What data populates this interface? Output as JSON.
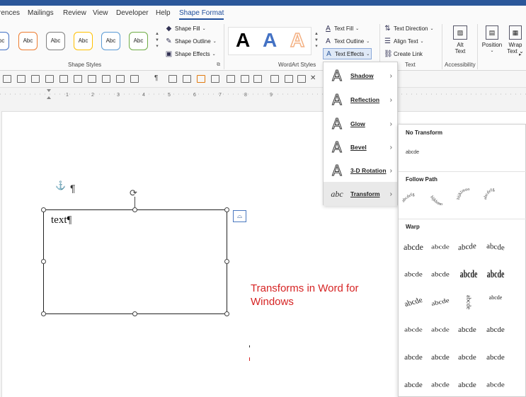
{
  "window": {
    "accent_color": "#2b579a",
    "menu_accent": "#1f4e9c"
  },
  "tabs": [
    "rences",
    "Mailings",
    "Review",
    "View",
    "Developer",
    "Help",
    "Shape Format"
  ],
  "ribbon": {
    "shape_styles": {
      "swatch_label": "Abc",
      "swatch_colors": [
        "#4472c4",
        "#ed7d31",
        "#7f7f7f",
        "#ffc000",
        "#5b9bd5",
        "#70ad47"
      ],
      "shape_fill": "Shape Fill",
      "shape_outline": "Shape Outline",
      "shape_effects": "Shape Effects",
      "group_label": "Shape Styles"
    },
    "wordart": {
      "letter": "A",
      "colors": [
        "#000000",
        "#4472c4",
        "#f4b183"
      ],
      "group_label": "WordArt Styles"
    },
    "text_group": {
      "text_fill": "Text Fill",
      "text_outline": "Text Outline",
      "text_effects": "Text Effects",
      "text_direction": "Text Direction",
      "align_text": "Align Text",
      "create_link": "Create Link",
      "group_label": "Text"
    },
    "accessibility": {
      "alt_text_1": "Alt",
      "alt_text_2": "Text",
      "group_label": "Accessibility"
    },
    "arrange": {
      "position": "Position",
      "wrap_1": "Wrap",
      "wrap_2": "Text"
    }
  },
  "document": {
    "shape_text": "text¶",
    "paragraph_mark": "¶",
    "anchor_icon": "anchor-icon",
    "note_line1": "Transforms in Word for",
    "note_line2": "Windows",
    "note_color": "#d62424"
  },
  "text_effects_menu": {
    "items": [
      {
        "label": "Shadow",
        "icon": "text-shadow-icon"
      },
      {
        "label": "Reflection",
        "icon": "text-reflection-icon"
      },
      {
        "label": "Glow",
        "icon": "text-glow-icon"
      },
      {
        "label": "Bevel",
        "icon": "text-bevel-icon"
      },
      {
        "label": "3-D Rotation",
        "icon": "text-3d-rotation-icon"
      },
      {
        "label": "Transform",
        "icon": "text-transform-icon"
      }
    ],
    "selected": "Transform"
  },
  "transform_gallery": {
    "no_transform_header": "No Transform",
    "no_transform_sample": "abcde",
    "follow_path_header": "Follow Path",
    "follow_path_samples": [
      "abcdefg",
      "hijklmno",
      "hijklmno",
      "abcdefg"
    ],
    "warp_header": "Warp",
    "warp_sample": "abcde"
  }
}
